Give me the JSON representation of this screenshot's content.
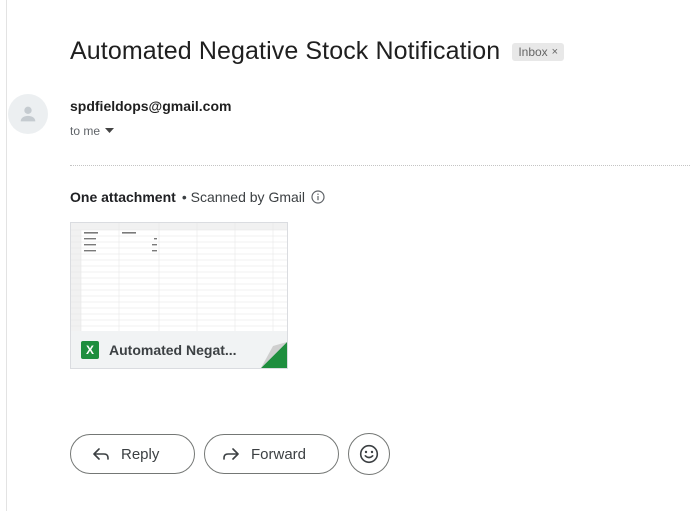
{
  "email": {
    "subject": "Automated Negative Stock Notification",
    "label": "Inbox",
    "label_remove": "×",
    "sender": "spdfieldops@gmail.com",
    "recipient": "to me"
  },
  "attachments": {
    "count_text": "One attachment",
    "scan_text": "• Scanned by Gmail",
    "file": {
      "name": "Automated Negat...",
      "type_glyph": "X",
      "type_icon": "excel-icon",
      "brand_color": "#1e8e3e"
    }
  },
  "actions": {
    "reply_label": "Reply",
    "forward_label": "Forward",
    "emoji_icon": "smiley-icon"
  }
}
